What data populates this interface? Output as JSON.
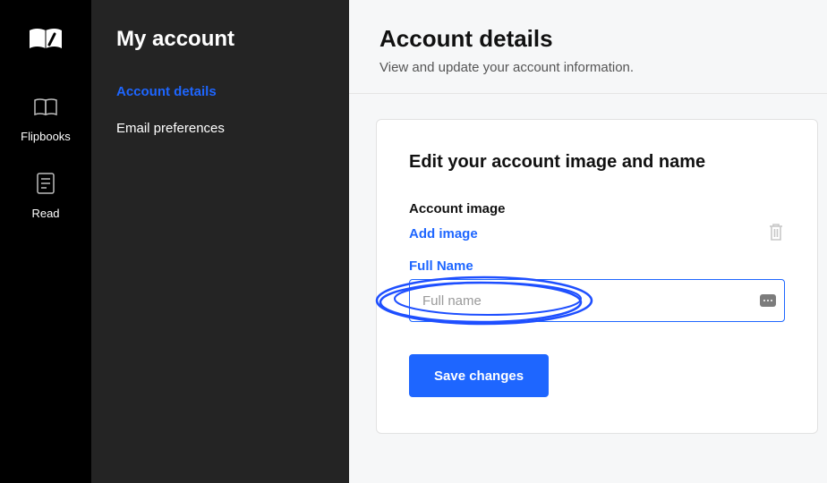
{
  "rail": {
    "items": [
      {
        "label": "Flipbooks"
      },
      {
        "label": "Read"
      }
    ]
  },
  "sidebar": {
    "title": "My account",
    "items": [
      {
        "label": "Account details"
      },
      {
        "label": "Email preferences"
      }
    ]
  },
  "main": {
    "title": "Account details",
    "subtitle": "View and update your account information."
  },
  "card": {
    "title": "Edit your account image and name",
    "account_image_label": "Account image",
    "add_image_label": "Add image",
    "full_name_label": "Full Name",
    "full_name_placeholder": "Full name",
    "save_label": "Save changes"
  }
}
